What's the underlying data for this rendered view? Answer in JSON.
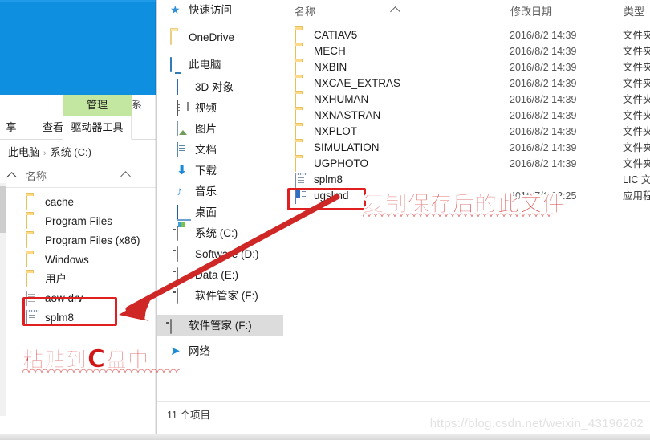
{
  "background_window": {
    "wallpaper_color": "#0f8fe0",
    "ribbon": {
      "tabs": [
        {
          "label": "享",
          "name": "tab-share"
        },
        {
          "label": "查看",
          "name": "tab-view"
        },
        {
          "label": "驱动器工具",
          "name": "tab-drive-tools"
        }
      ],
      "contextual_group": "管理",
      "contextual_group_color": "#c3e6a0",
      "right_cut_label": "系"
    },
    "breadcrumb": {
      "root": "此电脑",
      "separator": "›",
      "current": "系统 (C:)"
    },
    "column_header": "名称",
    "files": [
      {
        "name": "cache",
        "icon": "folder-icon"
      },
      {
        "name": "Program Files",
        "icon": "folder-icon"
      },
      {
        "name": "Program Files (x86)",
        "icon": "folder-icon"
      },
      {
        "name": "Windows",
        "icon": "folder-icon"
      },
      {
        "name": "用户",
        "icon": "folder-icon"
      },
      {
        "name": "aow drv",
        "icon": "document-icon"
      },
      {
        "name": "splm8",
        "icon": "notepad-file-icon"
      }
    ]
  },
  "explorer_window": {
    "nav_pane": [
      {
        "label": "快速访问",
        "icon": "star-icon",
        "depth": 0,
        "selected": false
      },
      {
        "label": "OneDrive",
        "icon": "folder-icon",
        "depth": 0,
        "selected": false
      },
      {
        "label": "此电脑",
        "icon": "this-pc-icon",
        "depth": 0,
        "selected": false
      },
      {
        "label": "3D 对象",
        "icon": "cube-icon",
        "depth": 1,
        "selected": false
      },
      {
        "label": "视频",
        "icon": "video-icon",
        "depth": 1,
        "selected": false
      },
      {
        "label": "图片",
        "icon": "picture-icon",
        "depth": 1,
        "selected": false
      },
      {
        "label": "文档",
        "icon": "document-icon",
        "depth": 1,
        "selected": false
      },
      {
        "label": "下载",
        "icon": "download-icon",
        "depth": 1,
        "selected": false
      },
      {
        "label": "音乐",
        "icon": "music-icon",
        "depth": 1,
        "selected": false
      },
      {
        "label": "桌面",
        "icon": "desktop-icon",
        "depth": 1,
        "selected": false
      },
      {
        "label": "系统 (C:)",
        "icon": "system-drive-icon",
        "depth": 1,
        "selected": false
      },
      {
        "label": "Software (D:)",
        "icon": "drive-icon",
        "depth": 1,
        "selected": false
      },
      {
        "label": "Data (E:)",
        "icon": "drive-icon",
        "depth": 1,
        "selected": false
      },
      {
        "label": "软件管家 (F:)",
        "icon": "drive-icon",
        "depth": 1,
        "selected": false
      },
      {
        "label": "软件管家 (F:)",
        "icon": "drive-icon",
        "depth": 0,
        "selected": true
      },
      {
        "label": "网络",
        "icon": "network-icon",
        "depth": 0,
        "selected": false
      }
    ],
    "columns": {
      "name": "名称",
      "date_modified": "修改日期",
      "type": "类型"
    },
    "rows": [
      {
        "name": "CATIAV5",
        "date": "2016/8/2 14:39",
        "type": "文件夹",
        "icon": "folder-icon"
      },
      {
        "name": "MECH",
        "date": "2016/8/2 14:39",
        "type": "文件夹",
        "icon": "folder-icon"
      },
      {
        "name": "NXBIN",
        "date": "2016/8/2 14:39",
        "type": "文件夹",
        "icon": "folder-icon"
      },
      {
        "name": "NXCAE_EXTRAS",
        "date": "2016/8/2 14:39",
        "type": "文件夹",
        "icon": "folder-icon"
      },
      {
        "name": "NXHUMAN",
        "date": "2016/8/2 14:39",
        "type": "文件夹",
        "icon": "folder-icon"
      },
      {
        "name": "NXNASTRAN",
        "date": "2016/8/2 14:39",
        "type": "文件夹",
        "icon": "folder-icon"
      },
      {
        "name": "NXPLOT",
        "date": "2016/8/2 14:39",
        "type": "文件夹",
        "icon": "folder-icon"
      },
      {
        "name": "SIMULATION",
        "date": "2016/8/2 14:39",
        "type": "文件夹",
        "icon": "folder-icon"
      },
      {
        "name": "UGPHOTO",
        "date": "2016/8/2 14:39",
        "type": "文件夹",
        "icon": "folder-icon"
      },
      {
        "name": "splm8",
        "date": "",
        "type": "LIC 文",
        "icon": "notepad-file-icon"
      },
      {
        "name": "ugslmd",
        "date": "2016/7/1 22:25",
        "type": "应用程",
        "icon": "application-icon"
      }
    ],
    "status_text": "11 个项目"
  },
  "annotations": {
    "right_note": "复制保存后的此文件",
    "left_note_prefix": "粘贴到",
    "left_note_c": "C",
    "left_note_suffix": "盘中",
    "color": "#d42b2b",
    "highlight_color": "#e02020"
  },
  "watermark": "https://blog.csdn.net/weixin_43196262"
}
